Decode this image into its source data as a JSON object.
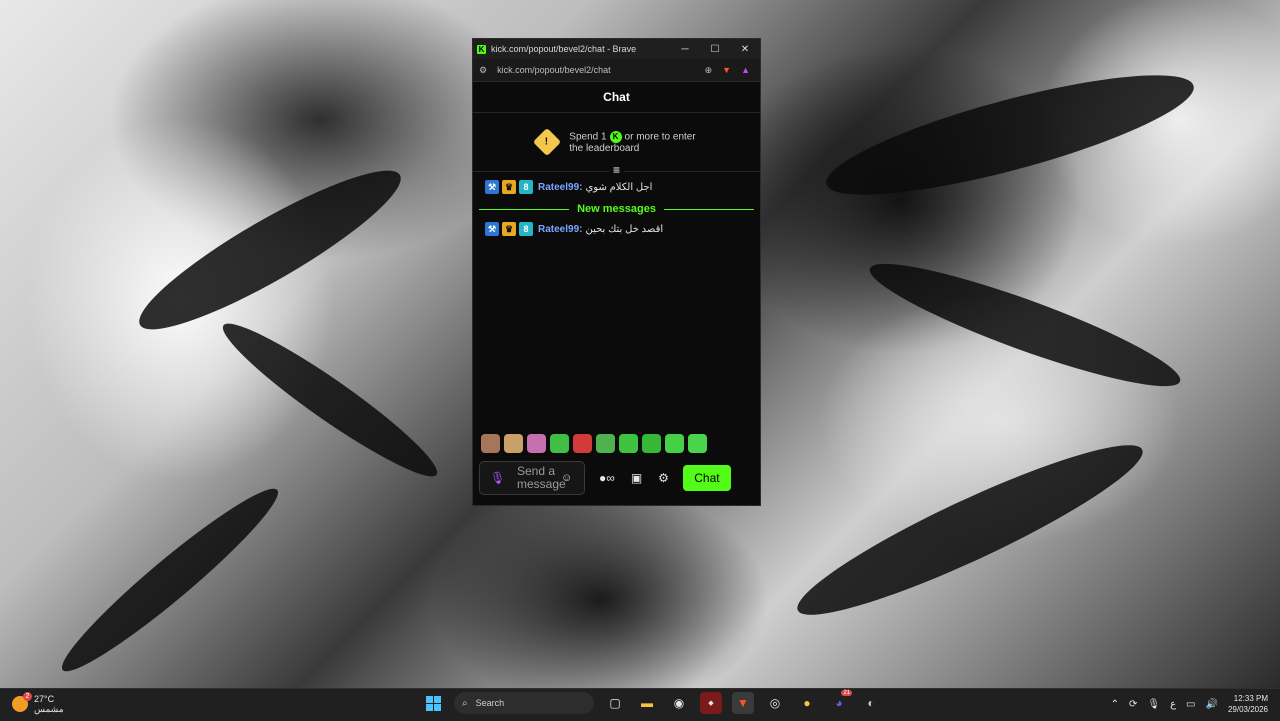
{
  "browser": {
    "window_title": "kick.com/popout/bevel2/chat - Brave",
    "url": "kick.com/popout/bevel2/chat",
    "minimize": "─",
    "maximize": "☐",
    "close": "✕"
  },
  "chat": {
    "header": "Chat",
    "leaderboard_prefix": "Spend 1",
    "leaderboard_suffix": "or more to enter",
    "leaderboard_line2": "the leaderboard",
    "messages": [
      {
        "username": "Rateel99:",
        "text": "اجل الكلام شوي"
      },
      {
        "username": "Rateel99:",
        "text": "اقصد خل بتك بحين"
      }
    ],
    "new_messages_label": "New messages",
    "input_placeholder": "Send a message",
    "send_button": "Chat"
  },
  "taskbar": {
    "temperature": "27°C",
    "weather_text": "مشمس",
    "weather_badge": "2",
    "search_label": "Search",
    "language": "ع",
    "time": "12:33 PM",
    "date": "29/03/2026",
    "discord_badge": "21"
  },
  "colors": {
    "kick_green": "#53fc18",
    "username_blue": "#7ba6ff",
    "mic_purple": "#b055ff",
    "chat_bg": "#0b0b0c"
  }
}
